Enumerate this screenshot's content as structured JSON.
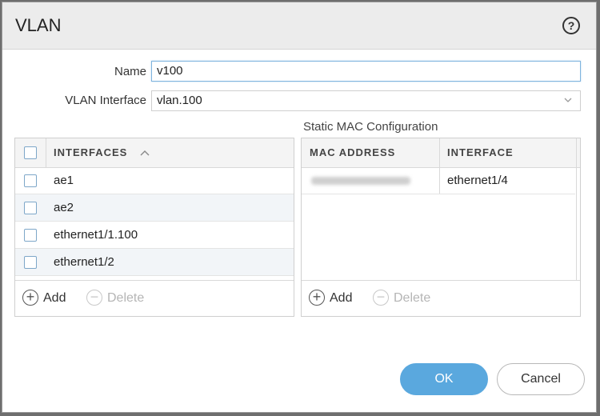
{
  "dialog": {
    "title": "VLAN",
    "help_icon": "?"
  },
  "form": {
    "name_label": "Name",
    "name_value": "v100",
    "vlan_interface_label": "VLAN Interface",
    "vlan_interface_value": "vlan.100"
  },
  "interfaces_table": {
    "header": "INTERFACES",
    "sort": "ascending",
    "rows": [
      "ae1",
      "ae2",
      "ethernet1/1.100",
      "ethernet1/2"
    ],
    "add_label": "Add",
    "delete_label": "Delete"
  },
  "static_mac": {
    "section_title": "Static MAC Configuration",
    "headers": [
      "MAC ADDRESS",
      "INTERFACE"
    ],
    "rows": [
      {
        "interface": "ethernet1/4"
      }
    ],
    "add_label": "Add",
    "delete_label": "Delete"
  },
  "buttons": {
    "ok": "OK",
    "cancel": "Cancel"
  },
  "colors": {
    "primary": "#5aa8de",
    "checkbox_border": "#7ea7c9",
    "row_alt": "#f2f5f8"
  }
}
